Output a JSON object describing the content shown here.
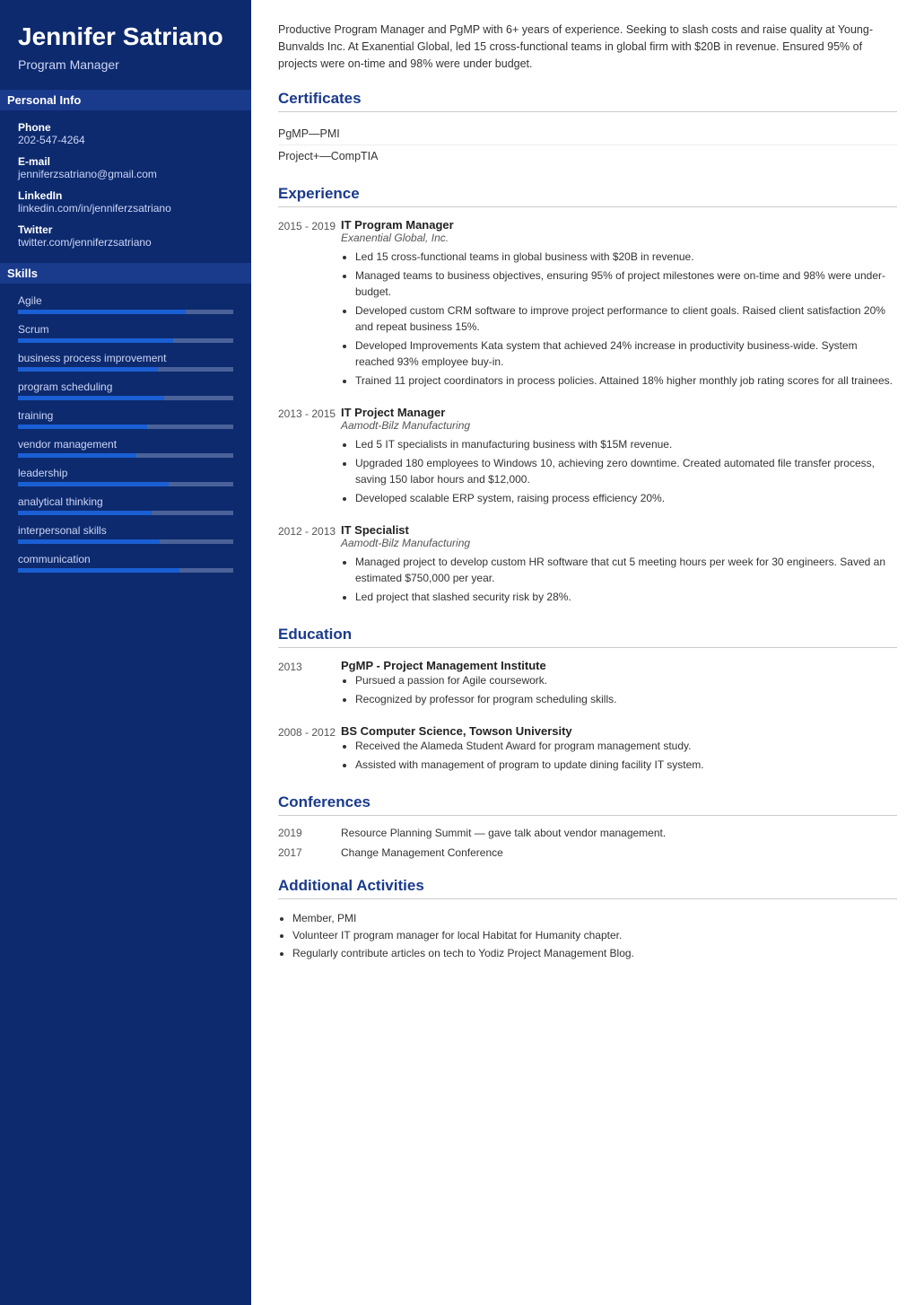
{
  "sidebar": {
    "name": "Jennifer Satriano",
    "title": "Program Manager",
    "personal_info_label": "Personal Info",
    "contacts": [
      {
        "label": "Phone",
        "value": "202-547-4264"
      },
      {
        "label": "E-mail",
        "value": "jenniferzsatriano@gmail.com"
      },
      {
        "label": "LinkedIn",
        "value": "linkedin.com/in/jenniferzsatriano"
      },
      {
        "label": "Twitter",
        "value": "twitter.com/jenniferzsatriano"
      }
    ],
    "skills_label": "Skills",
    "skills": [
      {
        "name": "Agile",
        "pct": 78
      },
      {
        "name": "Scrum",
        "pct": 72
      },
      {
        "name": "business process improvement",
        "pct": 65
      },
      {
        "name": "program scheduling",
        "pct": 68
      },
      {
        "name": "training",
        "pct": 60
      },
      {
        "name": "vendor management",
        "pct": 55
      },
      {
        "name": "leadership",
        "pct": 70
      },
      {
        "name": "analytical thinking",
        "pct": 62
      },
      {
        "name": "interpersonal skills",
        "pct": 66
      },
      {
        "name": "communication",
        "pct": 75
      }
    ]
  },
  "main": {
    "summary": "Productive Program Manager and PgMP with 6+ years of experience. Seeking to slash costs and raise quality at Young-Bunvalds Inc. At Exanential Global, led 15 cross-functional teams in global firm with $20B in revenue. Ensured 95% of projects were on-time and 98% were under budget.",
    "certificates_label": "Certificates",
    "certificates": [
      "PgMP—PMI",
      "Project+—CompTIA"
    ],
    "experience_label": "Experience",
    "experience": [
      {
        "date": "2015 - 2019",
        "title": "IT Program Manager",
        "company": "Exanential Global, Inc.",
        "bullets": [
          "Led 15 cross-functional teams in global business with $20B in revenue.",
          "Managed teams to business objectives, ensuring 95% of project milestones were on-time and 98% were under-budget.",
          "Developed custom CRM software to improve project performance to client goals. Raised client satisfaction 20% and repeat business 15%.",
          "Developed Improvements Kata system that achieved 24% increase in productivity business-wide. System reached 93% employee buy-in.",
          "Trained 11 project coordinators in process policies. Attained 18% higher monthly job rating scores for all trainees."
        ]
      },
      {
        "date": "2013 - 2015",
        "title": "IT Project Manager",
        "company": "Aamodt-Bilz Manufacturing",
        "bullets": [
          "Led 5 IT specialists in manufacturing business with $15M revenue.",
          "Upgraded 180 employees to Windows 10, achieving zero downtime. Created automated file transfer process, saving 150 labor hours and $12,000.",
          "Developed scalable ERP system, raising process efficiency 20%."
        ]
      },
      {
        "date": "2012 - 2013",
        "title": "IT Specialist",
        "company": "Aamodt-Bilz Manufacturing",
        "bullets": [
          "Managed project to develop custom HR software that cut 5 meeting hours per week for 30 engineers. Saved an estimated $750,000 per year.",
          "Led project that slashed security risk by 28%."
        ]
      }
    ],
    "education_label": "Education",
    "education": [
      {
        "date": "2013",
        "title": "PgMP - Project Management Institute",
        "company": "",
        "bullets": [
          "Pursued a passion for Agile coursework.",
          "Recognized by professor for program scheduling skills."
        ]
      },
      {
        "date": "2008 - 2012",
        "title": "BS Computer Science, Towson University",
        "company": "",
        "bullets": [
          "Received the Alameda Student Award for program management study.",
          "Assisted with management of program to update dining facility IT system."
        ]
      }
    ],
    "conferences_label": "Conferences",
    "conferences": [
      {
        "date": "2019",
        "text": "Resource Planning Summit — gave talk about vendor management."
      },
      {
        "date": "2017",
        "text": "Change Management Conference"
      }
    ],
    "activities_label": "Additional Activities",
    "activities": [
      "Member, PMI",
      "Volunteer IT program manager for local Habitat for Humanity chapter.",
      "Regularly contribute articles on tech to Yodiz Project Management Blog."
    ]
  }
}
